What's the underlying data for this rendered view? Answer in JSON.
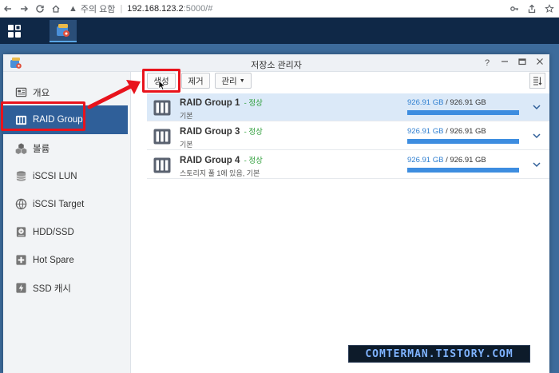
{
  "browser": {
    "security_text": "주의 요함",
    "url_host": "192.168.123.2",
    "url_path": ":5000/#"
  },
  "window": {
    "title": "저장소 관리자",
    "help_label": "?"
  },
  "sidebar": {
    "items": [
      {
        "label": "개요",
        "icon": "overview-icon"
      },
      {
        "label": "RAID Group",
        "icon": "raid-icon"
      },
      {
        "label": "볼륨",
        "icon": "volume-icon"
      },
      {
        "label": "iSCSI LUN",
        "icon": "lun-icon"
      },
      {
        "label": "iSCSI Target",
        "icon": "target-icon"
      },
      {
        "label": "HDD/SSD",
        "icon": "hdd-icon"
      },
      {
        "label": "Hot Spare",
        "icon": "hot-spare-icon"
      },
      {
        "label": "SSD 캐시",
        "icon": "ssd-cache-icon"
      }
    ],
    "active_index": 1
  },
  "toolbar": {
    "create_label": "생성",
    "remove_label": "제거",
    "manage_label": "관리"
  },
  "raid_groups": [
    {
      "name": "RAID Group 1",
      "status": "- 정상",
      "desc": "기본",
      "used": "926.91 GB",
      "total": "/ 926.91 GB",
      "fill_percent": 100,
      "selected": true
    },
    {
      "name": "RAID Group 3",
      "status": "- 정상",
      "desc": "기본",
      "used": "926.91 GB",
      "total": "/ 926.91 GB",
      "fill_percent": 100,
      "selected": false
    },
    {
      "name": "RAID Group 4",
      "status": "- 정상",
      "desc": "스토리지 풀 1에 있음, 기본",
      "used": "926.91 GB",
      "total": "/ 926.91 GB",
      "fill_percent": 100,
      "selected": false
    }
  ],
  "watermark": "COMTERMAN.TISTORY.COM",
  "colors": {
    "accent": "#2f5f99",
    "status_ok": "#2e9e3a",
    "bar": "#3d8de0",
    "highlight": "#e8131c"
  }
}
